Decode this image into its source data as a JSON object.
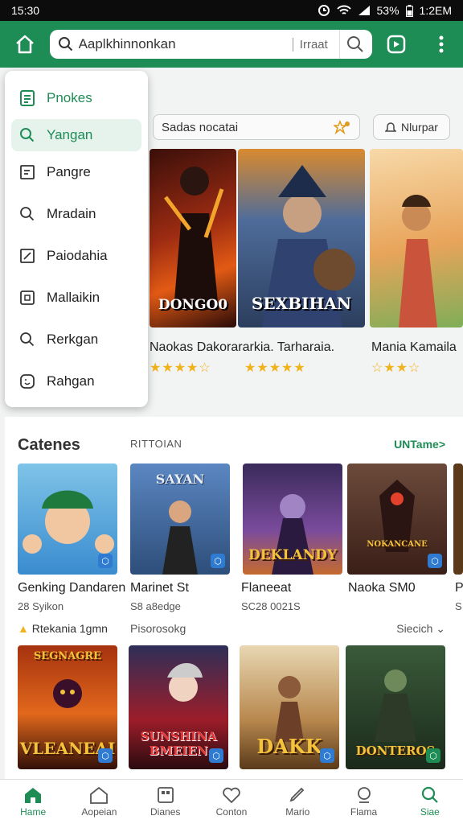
{
  "status": {
    "time": "15:30",
    "battery": "53%",
    "right_time": "1:2EM"
  },
  "header": {
    "search_value": "Aaplkhinnonkan",
    "search_suffix": "Irraat"
  },
  "filter": {
    "placeholder": "Sadas nocatai",
    "button_label": "Nlurpar"
  },
  "featured": [
    {
      "title": "Naokas Dakorararkia. Tarharaia.",
      "logo": "DONGO0",
      "rating": "★★★★☆"
    },
    {
      "title": "",
      "logo": "SEXBIHAN",
      "rating": "★★★★★"
    },
    {
      "title": "Mania Kamaila",
      "logo": "",
      "rating": "☆★★☆"
    }
  ],
  "dropdown": {
    "items": [
      {
        "label": "Pnokes",
        "icon": "document-icon"
      },
      {
        "label": "Yangan",
        "icon": "search-icon"
      },
      {
        "label": "Pangre",
        "icon": "list-icon"
      },
      {
        "label": "Mradain",
        "icon": "search-icon"
      },
      {
        "label": "Paiodahia",
        "icon": "edit-icon"
      },
      {
        "label": "Mallaikin",
        "icon": "frame-icon"
      },
      {
        "label": "Rerkgan",
        "icon": "search-icon"
      },
      {
        "label": "Rahgan",
        "icon": "smile-icon"
      }
    ]
  },
  "section": {
    "title": "Catenes",
    "subtitle": "RITTOIAN",
    "link": "UNTame>"
  },
  "row1": [
    {
      "name": "Genking Dandaren",
      "meta": "28 Syikon",
      "logo": ""
    },
    {
      "name": "Marinet St",
      "meta": "S8 a8edge",
      "logo": "SAYAN"
    },
    {
      "name": "Flaneeat",
      "meta": "SC28 0021S",
      "logo": "DEKLANDY"
    },
    {
      "name": "Naoka SM0",
      "meta": "",
      "logo": "NOKANCANE"
    },
    {
      "name": "P",
      "meta": "S",
      "logo": ""
    }
  ],
  "row2_label": {
    "left": "Rtekania 1gmn",
    "middle": "Pisorosokg",
    "sort": "Siecich ⌄"
  },
  "row2": [
    {
      "logo_top": "SEGNAGRE",
      "logo": "VLEANEAI"
    },
    {
      "logo_top": "",
      "logo": "SUNSHINA BMEIEN"
    },
    {
      "logo_top": "",
      "logo": "DAKK"
    },
    {
      "logo_top": "",
      "logo": "DONTEROS"
    }
  ],
  "nav": [
    {
      "label": "Hame",
      "icon": "home-icon"
    },
    {
      "label": "Aopeian",
      "icon": "house-outline-icon"
    },
    {
      "label": "Dianes",
      "icon": "grid-icon"
    },
    {
      "label": "Conton",
      "icon": "heart-icon"
    },
    {
      "label": "Mario",
      "icon": "pen-icon"
    },
    {
      "label": "Flama",
      "icon": "profile-icon"
    },
    {
      "label": "Siae",
      "icon": "search-icon"
    }
  ],
  "colors": {
    "accent": "#1e8c55",
    "accent_light": "#e6f2ec",
    "star": "#f1b21c"
  }
}
